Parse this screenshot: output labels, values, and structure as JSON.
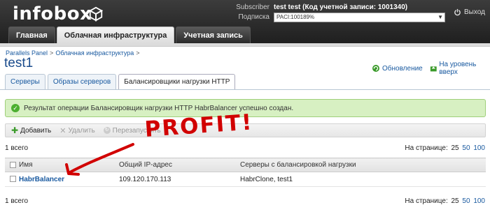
{
  "header": {
    "logo": "infobox",
    "subscriber_label": "Subscriber",
    "subscriber_value": "test test (Код учетной записи: 1001340)",
    "plan_label": "Подписка",
    "plan_value": "PACI:100189%",
    "logout_label": "Выход",
    "nav": [
      {
        "label": "Главная",
        "active": false
      },
      {
        "label": "Облачная инфраструктура",
        "active": true
      },
      {
        "label": "Учетная запись",
        "active": false
      }
    ]
  },
  "breadcrumb": [
    "Parallels Panel",
    "Облачная инфраструктура"
  ],
  "page_title": "test1",
  "top_actions": {
    "refresh": "Обновление",
    "up_level": "На уровень вверх"
  },
  "content_tabs": [
    {
      "label": "Серверы",
      "active": false
    },
    {
      "label": "Образы серверов",
      "active": false
    },
    {
      "label": "Балансировщики нагрузки HTTP",
      "active": true
    }
  ],
  "message": "Результат операции Балансировщик нагрузки HTTP HabrBalancer успешно создан.",
  "toolbar": {
    "add": "Добавить",
    "delete": "Удалить",
    "restart": "Перезапустить"
  },
  "count_text": "1 всего",
  "pager": {
    "label": "На странице:",
    "current": "25",
    "options": [
      "50",
      "100"
    ]
  },
  "table": {
    "columns": [
      "Имя",
      "Общий IP-адрес",
      "Серверы с балансировкой нагрузки"
    ],
    "rows": [
      {
        "name": "HabrBalancer",
        "ip": "109.120.170.113",
        "servers": "HabrClone, test1"
      }
    ]
  },
  "annotation": {
    "text": "PROFIT!",
    "color": "#d10000"
  },
  "colors": {
    "link": "#1a5aa0",
    "success_bg": "#d7f0c2",
    "header_bg": "#2a2a2a"
  }
}
